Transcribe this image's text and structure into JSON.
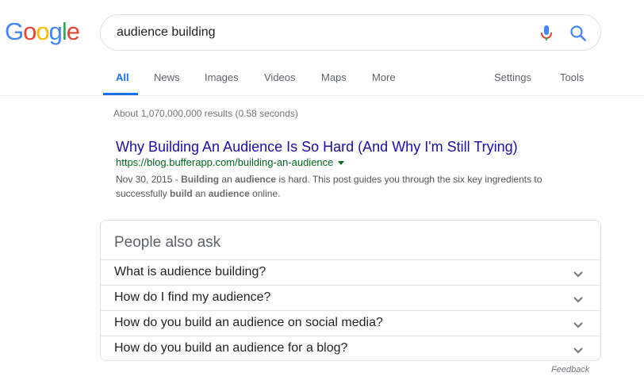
{
  "header": {
    "logo_letters": [
      "G",
      "o",
      "o",
      "g",
      "l",
      "e"
    ],
    "search": {
      "query": "audience building"
    },
    "icons": {
      "mic": "mic-icon",
      "search": "search-icon"
    }
  },
  "tabs": [
    {
      "label": "All",
      "active": true
    },
    {
      "label": "News"
    },
    {
      "label": "Images"
    },
    {
      "label": "Videos"
    },
    {
      "label": "Maps"
    },
    {
      "label": "More"
    },
    {
      "label": "Settings"
    },
    {
      "label": "Tools"
    }
  ],
  "results": {
    "stats": "About 1,070,000,000 results (0.58 seconds)",
    "items": [
      {
        "title": "Why Building An Audience Is So Hard (And Why I'm Still Trying)",
        "url": "https://blog.bufferapp.com/building-an-audience",
        "snippet": {
          "date": "Nov 30, 2015 - ",
          "w1": "Building",
          "t1": " an ",
          "w2": "audience",
          "t2": " is hard. This post guides you through the six key ingredients to successfully ",
          "w3": "build",
          "t3": " an ",
          "w4": "audience",
          "t4": " online."
        }
      }
    ]
  },
  "people_also_ask": {
    "title": "People also ask",
    "questions": [
      "What is audience building?",
      "How do I find my audience?",
      "How do you build an audience on social media?",
      "How do you build an audience for a blog?"
    ]
  },
  "footer": {
    "feedback": "Feedback"
  },
  "colors": {
    "blue": "#4285F4",
    "red": "#EA4335",
    "yellow": "#FBBC05",
    "green": "#34A853",
    "link": "#1a0dab",
    "url": "#006621",
    "active_tab": "#1a73e8"
  }
}
